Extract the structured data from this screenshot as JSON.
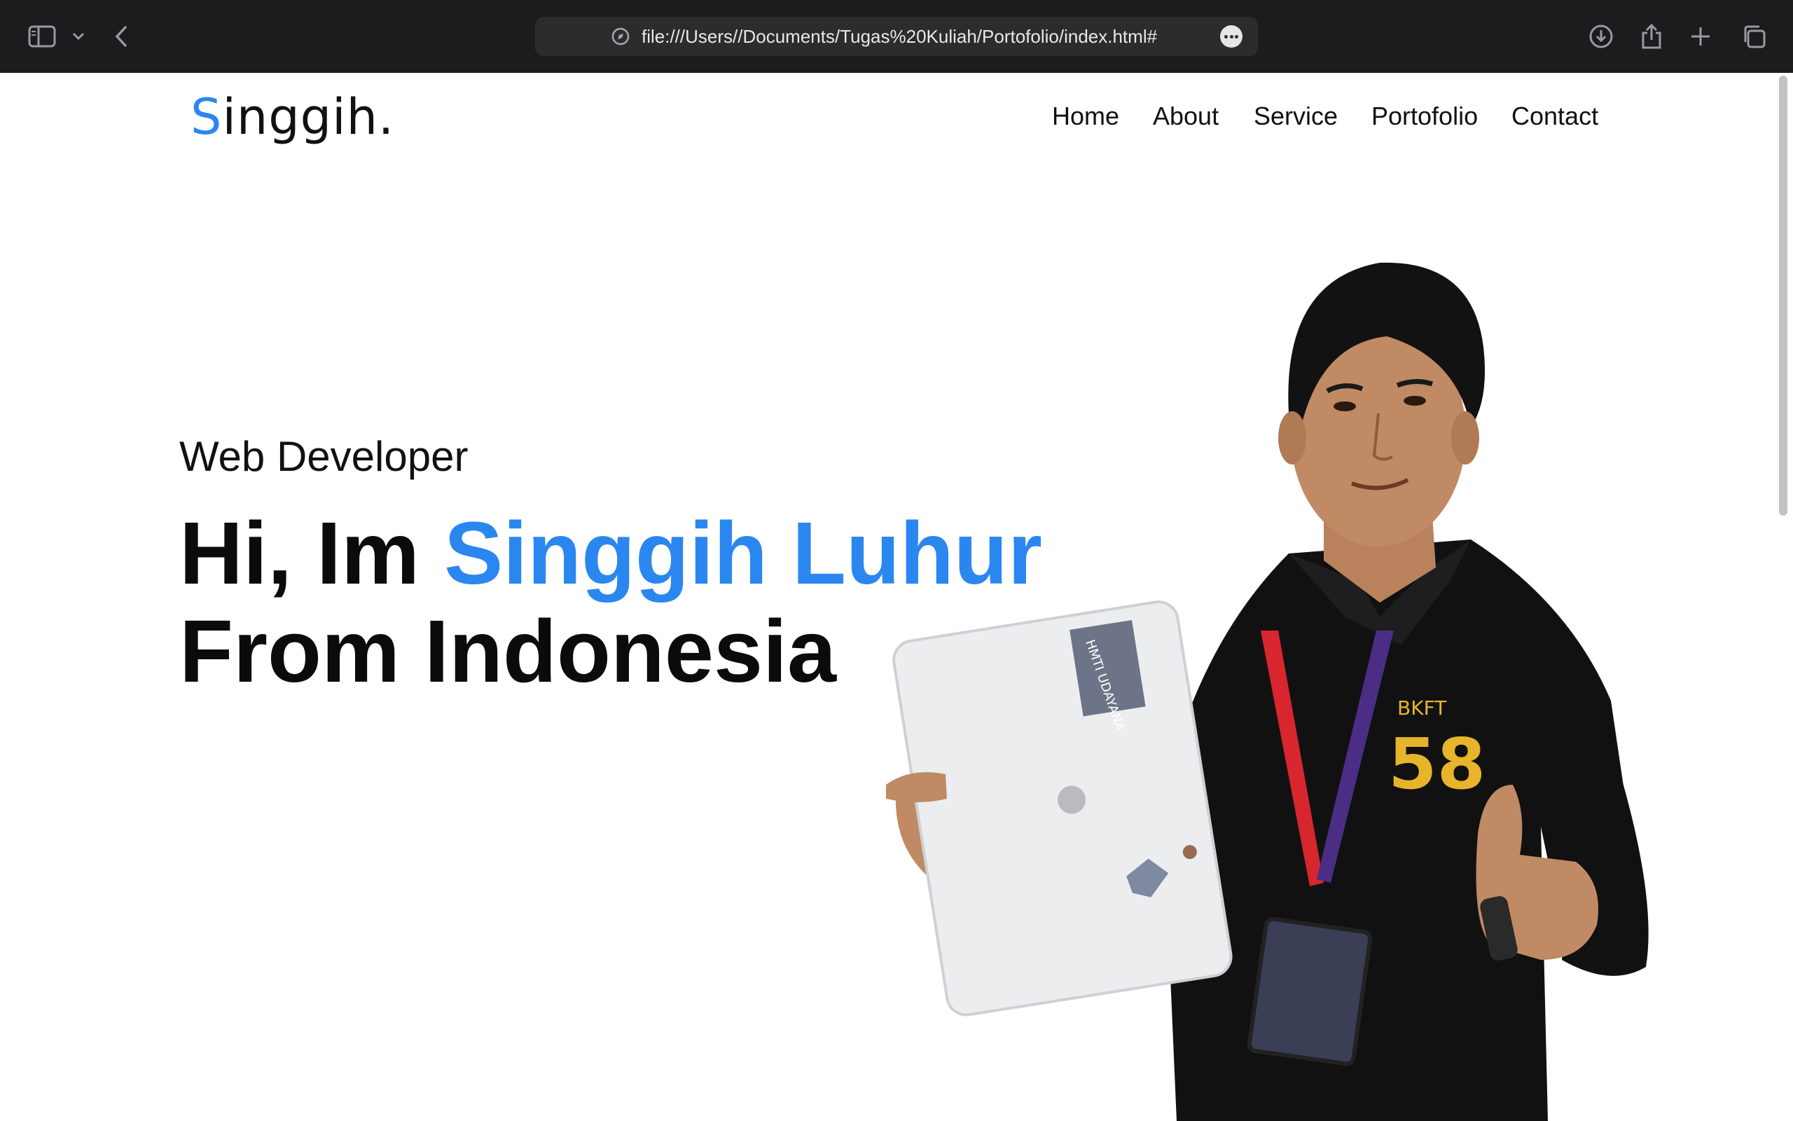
{
  "browser": {
    "url": "file:///Users//Documents/Tugas%20Kuliah/Portofolio/index.html#",
    "icons": [
      "sidebar-icon",
      "chevron-down-icon",
      "back-icon",
      "compass-icon",
      "more-icon",
      "download-icon",
      "share-icon",
      "new-tab-icon",
      "tabs-overview-icon"
    ]
  },
  "site": {
    "logo_first": "S",
    "logo_rest": "inggih.",
    "nav": [
      {
        "label": "Home"
      },
      {
        "label": "About"
      },
      {
        "label": "Service"
      },
      {
        "label": "Portofolio"
      },
      {
        "label": "Contact"
      }
    ]
  },
  "hero": {
    "subtitle": "Web Developer",
    "greeting": "Hi, Im ",
    "name": "Singgih Luhur",
    "line2": "From Indonesia",
    "photo": {
      "sticker_text": "HMTI UDAYANA",
      "shirt_text": "BKFT",
      "shirt_number": "58"
    }
  },
  "colors": {
    "accent": "#2b87f0",
    "chrome_bg": "#1c1c1e",
    "urlbar_bg": "#2c2c2e",
    "text": "#111111"
  }
}
